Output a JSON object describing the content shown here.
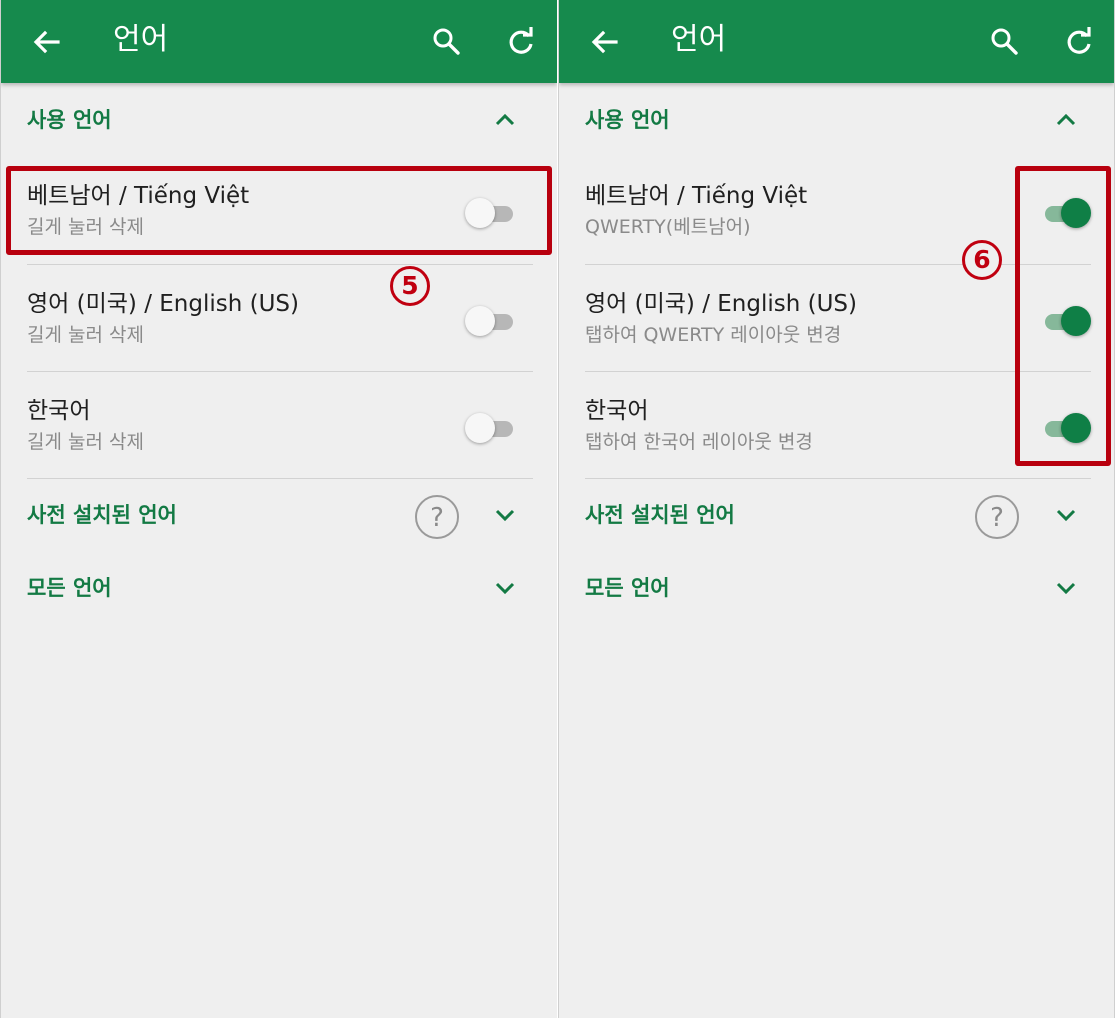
{
  "colors": {
    "appbar": "#168a4d",
    "section_title": "#137a44",
    "toggle_on": "#0f7f46",
    "highlight": "#b8000e"
  },
  "panels": [
    {
      "appbar": {
        "title": "언어",
        "back_icon": "arrow-left-icon",
        "search_icon": "search-icon",
        "refresh_icon": "refresh-icon"
      },
      "sections": {
        "used": {
          "title": "사용 언어",
          "icon": "chevron-up-icon"
        },
        "preinstalled": {
          "title": "사전 설치된 언어",
          "icon": "chevron-down-icon",
          "help_icon": "help-circle-icon"
        },
        "all": {
          "title": "모든 언어",
          "icon": "chevron-down-icon"
        }
      },
      "languages": [
        {
          "name": "베트남어 / Tiếng Việt",
          "sub": "길게 눌러 삭제",
          "enabled": false
        },
        {
          "name": "영어 (미국) / English (US)",
          "sub": "길게 눌러 삭제",
          "enabled": false
        },
        {
          "name": "한국어",
          "sub": "길게 눌러 삭제",
          "enabled": false
        }
      ],
      "step_marker": "5"
    },
    {
      "appbar": {
        "title": "언어",
        "back_icon": "arrow-left-icon",
        "search_icon": "search-icon",
        "refresh_icon": "refresh-icon"
      },
      "sections": {
        "used": {
          "title": "사용 언어",
          "icon": "chevron-up-icon"
        },
        "preinstalled": {
          "title": "사전 설치된 언어",
          "icon": "chevron-down-icon",
          "help_icon": "help-circle-icon"
        },
        "all": {
          "title": "모든 언어",
          "icon": "chevron-down-icon"
        }
      },
      "languages": [
        {
          "name": "베트남어 / Tiếng Việt",
          "sub": "QWERTY(베트남어)",
          "enabled": true
        },
        {
          "name": "영어 (미국) / English (US)",
          "sub": "탭하여 QWERTY 레이아웃 변경",
          "enabled": true
        },
        {
          "name": "한국어",
          "sub": "탭하여 한국어 레이아웃 변경",
          "enabled": true
        }
      ],
      "step_marker": "6"
    }
  ]
}
